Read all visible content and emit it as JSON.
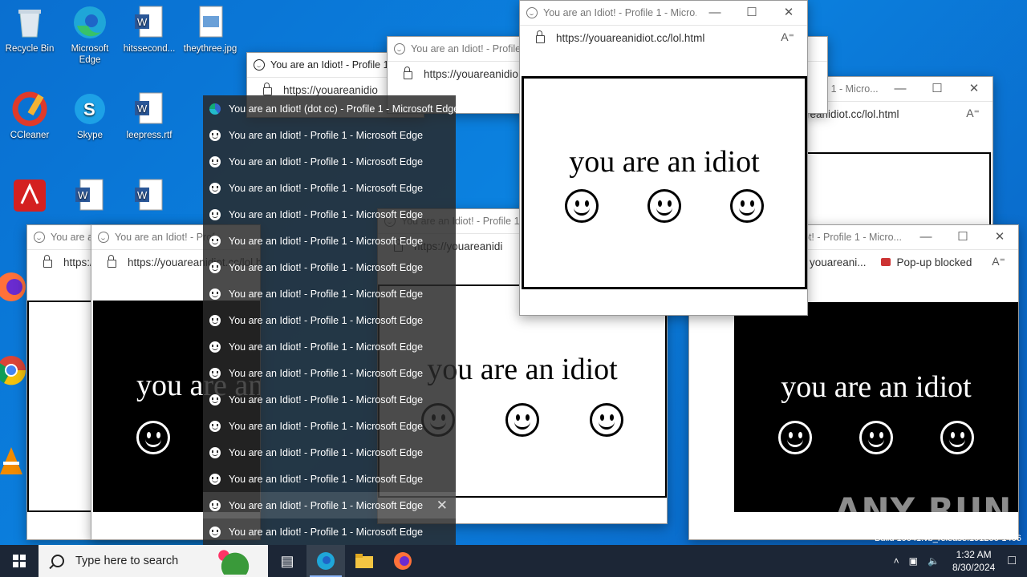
{
  "desktop": {
    "icons": [
      {
        "label": "Recycle Bin",
        "icon": "recycle-bin-icon"
      },
      {
        "label": "Microsoft Edge",
        "icon": "edge-icon"
      },
      {
        "label": "hitssecond...",
        "icon": "word-doc-icon"
      },
      {
        "label": "theythree.jpg",
        "icon": "image-file-icon"
      },
      {
        "label": "CCleaner",
        "icon": "ccleaner-icon"
      },
      {
        "label": "Skype",
        "icon": "skype-icon"
      },
      {
        "label": "leepress.rtf",
        "icon": "word-doc-icon"
      },
      {
        "label": "Adobe Acrobat",
        "icon": "acrobat-icon"
      },
      {
        "label": "Firefox",
        "icon": "firefox-icon"
      },
      {
        "label": "Google Chrome",
        "icon": "chrome-icon"
      },
      {
        "label": "VLC media player",
        "icon": "vlc-icon"
      }
    ]
  },
  "browser": {
    "window_title": "You are an Idiot! - Profile 1 - Micro...",
    "window_title_short": "You are an Idiot! - Profile 1 -",
    "url": "https://youareanidiot.cc/lol.html",
    "url_short": "https://youareanidio",
    "url_right": "reanidiot.cc/lol.html",
    "url_mid": "https://youareanidi",
    "url_fragment": "youareani...",
    "popup_blocked": "Pop-up blocked",
    "title_right": "rofile 1 - Micro...",
    "title_right2": "ot! - Profile 1 - Micro...",
    "title_left_a": "You are an",
    "title_left_b": "You are an Idiot! - Prof",
    "page_text": "you are an idiot"
  },
  "tab_preview": {
    "items": [
      "You are an Idiot! (dot cc) - Profile 1 - Microsoft Edge",
      "You are an Idiot! - Profile 1 - Microsoft Edge",
      "You are an Idiot! - Profile 1 - Microsoft Edge",
      "You are an Idiot! - Profile 1 - Microsoft Edge",
      "You are an Idiot! - Profile 1 - Microsoft Edge",
      "You are an Idiot! - Profile 1 - Microsoft Edge",
      "You are an Idiot! - Profile 1 - Microsoft Edge",
      "You are an Idiot! - Profile 1 - Microsoft Edge",
      "You are an Idiot! - Profile 1 - Microsoft Edge",
      "You are an Idiot! - Profile 1 - Microsoft Edge",
      "You are an Idiot! - Profile 1 - Microsoft Edge",
      "You are an Idiot! - Profile 1 - Microsoft Edge",
      "You are an Idiot! - Profile 1 - Microsoft Edge",
      "You are an Idiot! - Profile 1 - Microsoft Edge",
      "You are an Idiot! - Profile 1 - Microsoft Edge",
      "You are an Idiot! - Profile 1 - Microsoft Edge",
      "You are an Idiot! - Profile 1 - Microsoft Edge"
    ],
    "selected_index": 15
  },
  "taskbar": {
    "search_placeholder": "Type here to search",
    "time": "1:32 AM",
    "date": "8/30/2024"
  },
  "watermark": "ANY RUN",
  "build_text": "Build 19041.vb_release.191206-1406"
}
